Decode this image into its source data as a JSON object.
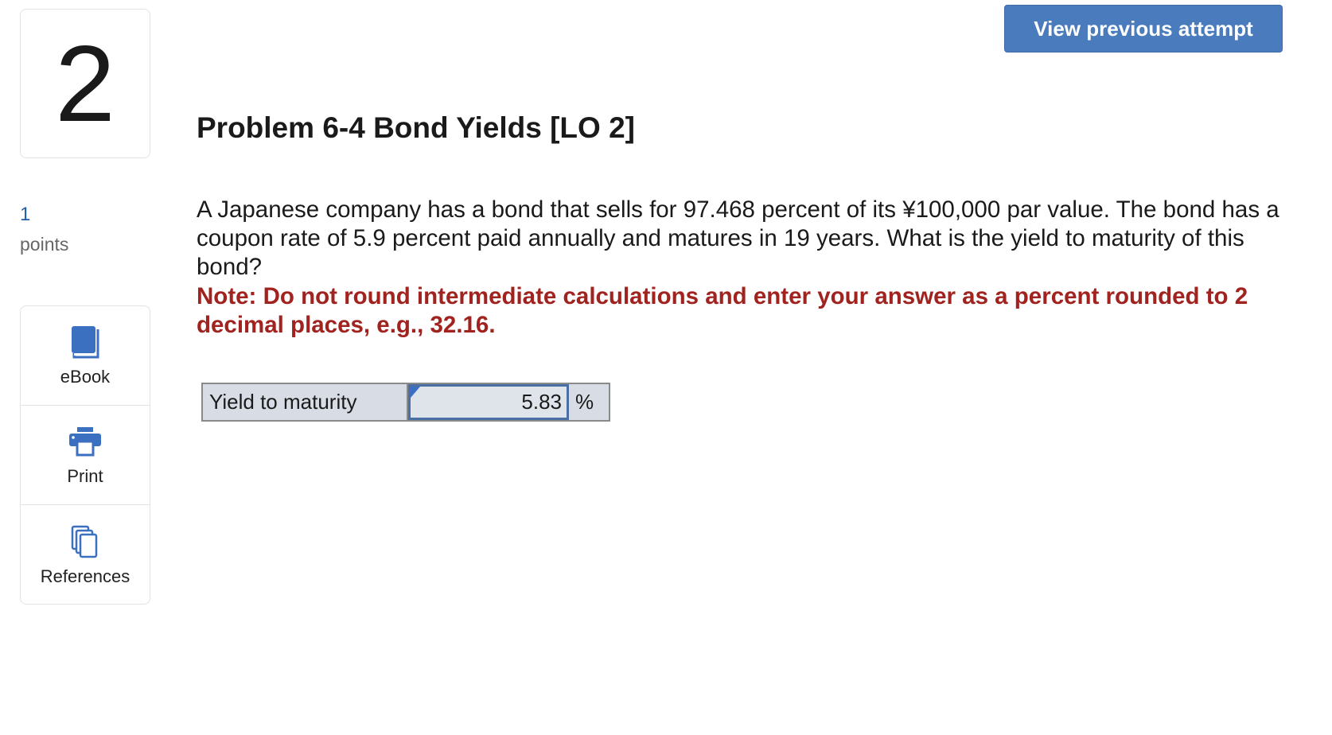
{
  "question_number": "2",
  "points": {
    "value": "1",
    "label": "points"
  },
  "tools": [
    {
      "label": "eBook",
      "icon": "book-icon"
    },
    {
      "label": "Print",
      "icon": "printer-icon"
    },
    {
      "label": "References",
      "icon": "copy-icon"
    }
  ],
  "header": {
    "view_previous_label": "View previous attempt"
  },
  "problem": {
    "title": "Problem 6-4 Bond Yields [LO 2]",
    "question": "A Japanese company has a bond that sells for 97.468 percent of its ¥100,000 par value. The bond has a coupon rate of 5.9 percent paid annually and matures in 19 years. What is the yield to maturity of this bond?",
    "note": "Note: Do not round intermediate calculations and enter your answer as a percent rounded to 2 decimal places, e.g., 32.16."
  },
  "answer": {
    "label": "Yield to maturity",
    "value": "5.83",
    "unit": "%"
  },
  "colors": {
    "button_bg": "#4a7bbd",
    "note_text": "#a0231f",
    "icon_blue": "#3b6fc0",
    "points_blue": "#1f5fa8"
  }
}
